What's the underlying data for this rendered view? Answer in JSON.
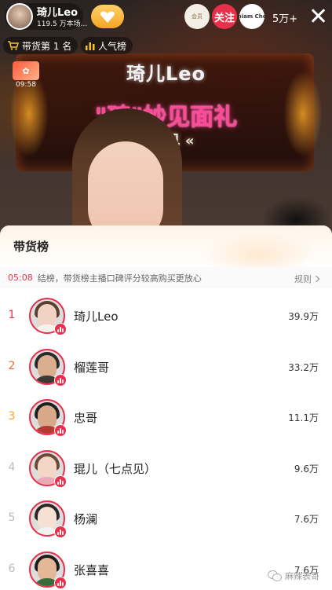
{
  "host": {
    "name": "琦儿Leo",
    "meta": "119.5 万本场..."
  },
  "topbar": {
    "brand_1_label": "会员",
    "follow_label": "关注",
    "brand_2_label": "Chiam Choo",
    "viewers": "5万+"
  },
  "badges": {
    "sales_rank": "带货第 1 名",
    "popularity": "人气榜"
  },
  "event": {
    "time": "09:58"
  },
  "stage": {
    "board_title": "琦儿Leo",
    "board_slogan": "\"琦\"妙见面礼",
    "board_sub": "七点见 «"
  },
  "ranking": {
    "title": "带货榜",
    "notice_time": "05:08",
    "notice_text": "结榜，带货榜主播口碑评分较高购买更放心",
    "rules_label": "规则",
    "rows": [
      {
        "rank": "1",
        "name": "琦儿Leo",
        "value": "39.9万"
      },
      {
        "rank": "2",
        "name": "榴莲哥",
        "value": "33.2万"
      },
      {
        "rank": "3",
        "name": "忠哥",
        "value": "11.1万"
      },
      {
        "rank": "4",
        "name": "琨儿（七点见）",
        "value": "9.6万"
      },
      {
        "rank": "5",
        "name": "杨澜",
        "value": "7.6万"
      },
      {
        "rank": "6",
        "name": "张喜喜",
        "value": "7.6万"
      }
    ]
  },
  "watermark": "麻辣表哥",
  "colors": {
    "accent_red": "#e8304a",
    "rank_2": "#f56b2a",
    "rank_3": "#f5a623"
  }
}
